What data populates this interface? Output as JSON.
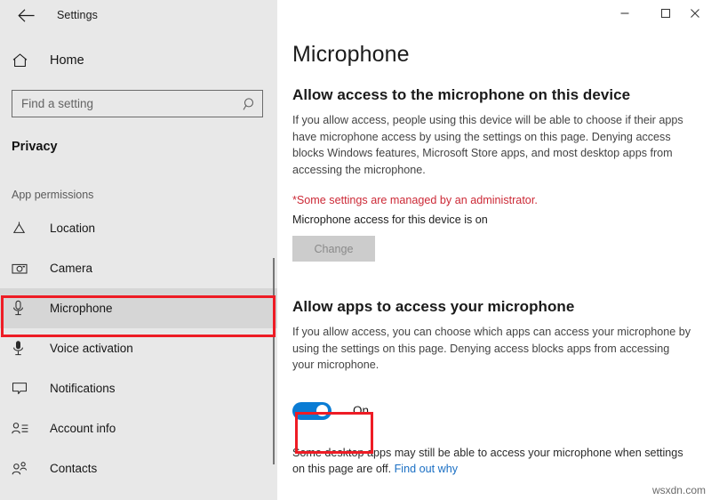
{
  "window": {
    "app_title": "Settings",
    "back_icon": "back-arrow-icon",
    "controls": [
      {
        "name": "minimize",
        "glyph": "─"
      },
      {
        "name": "maximize",
        "glyph": "□"
      },
      {
        "name": "close",
        "glyph": "✕"
      }
    ]
  },
  "sidebar": {
    "home_label": "Home",
    "home_icon": "home-icon",
    "search": {
      "placeholder": "Find a setting",
      "value": "",
      "icon": "search-icon"
    },
    "section_title": "Privacy",
    "group_label": "App permissions",
    "items": [
      {
        "label": "Location",
        "icon": "location-icon",
        "selected": false
      },
      {
        "label": "Camera",
        "icon": "camera-icon",
        "selected": false
      },
      {
        "label": "Microphone",
        "icon": "microphone-icon",
        "selected": true
      },
      {
        "label": "Voice activation",
        "icon": "voice-activation-icon",
        "selected": false
      },
      {
        "label": "Notifications",
        "icon": "notification-icon",
        "selected": false
      },
      {
        "label": "Account info",
        "icon": "account-info-icon",
        "selected": false
      },
      {
        "label": "Contacts",
        "icon": "contacts-icon",
        "selected": false
      }
    ]
  },
  "main": {
    "page_title": "Microphone",
    "device_section": {
      "heading": "Allow access to the microphone on this device",
      "description": "If you allow access, people using this device will be able to choose if their apps have microphone access by using the settings on this page. Denying access blocks Windows features, Microsoft Store apps, and most desktop apps from accessing the microphone.",
      "admin_note": "*Some settings are managed by an administrator.",
      "status": "Microphone access for this device is on",
      "change_button": "Change",
      "change_button_disabled": true
    },
    "apps_section": {
      "heading": "Allow apps to access your microphone",
      "description": "If you allow access, you can choose which apps can access your microphone by using the settings on this page. Denying access blocks apps from accessing your microphone.",
      "toggle_state": "On",
      "toggle_on": true,
      "footer_text": "Some desktop apps may still be able to access your microphone when settings on this page are off. ",
      "footer_link": "Find out why"
    }
  },
  "colors": {
    "accent_blue": "#0a7cd4",
    "highlight_red": "#ee1c25",
    "link_blue": "#1a6fc4",
    "warning_red": "#cc2936",
    "sidebar_bg": "#e8e8e8",
    "selected_bg": "#d6d6d6"
  },
  "watermark": "wsxdn.com"
}
